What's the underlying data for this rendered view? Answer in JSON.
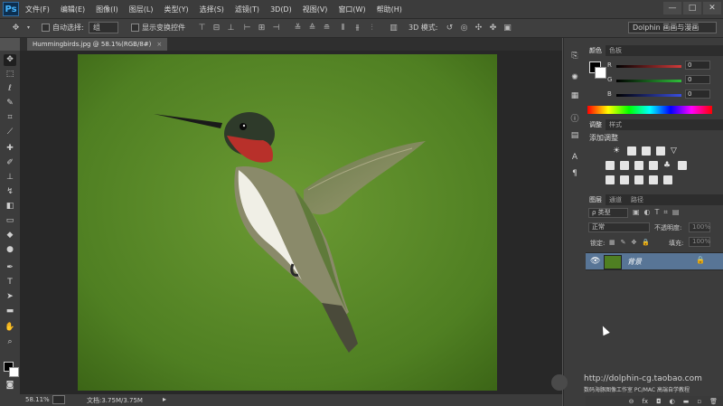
{
  "app": {
    "logo": "Ps"
  },
  "menubar": {
    "items": [
      "文件(F)",
      "编辑(E)",
      "图像(I)",
      "图层(L)",
      "类型(Y)",
      "选择(S)",
      "滤镜(T)",
      "3D(D)",
      "视图(V)",
      "窗口(W)",
      "帮助(H)"
    ],
    "window_controls": [
      "—",
      "□",
      "✕"
    ]
  },
  "options": {
    "auto_select_label": "自动选择:",
    "auto_select_value": "组",
    "show_transform_label": "显示变换控件",
    "mode_3d_label": "3D 模式:",
    "workspace": "Dolphin 画画与漫画"
  },
  "document": {
    "tab_title": "Hummingbirds.jpg @ 58.1%(RGB/8#)",
    "zoom": "58.11%",
    "doc_info": "文档:3.75M/3.75M"
  },
  "color_panel": {
    "tabs": [
      "颜色",
      "色板"
    ],
    "channels": [
      {
        "label": "R",
        "value": "0",
        "color": "#d13a3a"
      },
      {
        "label": "G",
        "value": "0",
        "color": "#2fbf3a"
      },
      {
        "label": "B",
        "value": "0",
        "color": "#3a4fe0"
      }
    ]
  },
  "adjust_panel": {
    "tabs": [
      "调整",
      "样式"
    ],
    "title": "添加调整"
  },
  "layers_panel": {
    "tabs": [
      "图层",
      "通道",
      "路径"
    ],
    "kind_label": "ρ 类型",
    "blend_mode": "正常",
    "opacity_label": "不透明度:",
    "opacity_value": "100%",
    "lock_label": "锁定:",
    "fill_label": "填充:",
    "fill_value": "100%",
    "layers": [
      {
        "name": "背景",
        "visible": true,
        "locked": true
      }
    ]
  },
  "watermark": {
    "url": "http://dolphin-cg.taobao.com",
    "subtitle": "数码海豚图像工作室 PC/MAC 高端自学教程"
  },
  "colors": {
    "menubar_bg": "#3c3c3c",
    "panel_bg": "#3c3c3c",
    "workspace_bg": "#282828",
    "layer_selected": "#587596",
    "photo_green": "#5a8a2a"
  }
}
